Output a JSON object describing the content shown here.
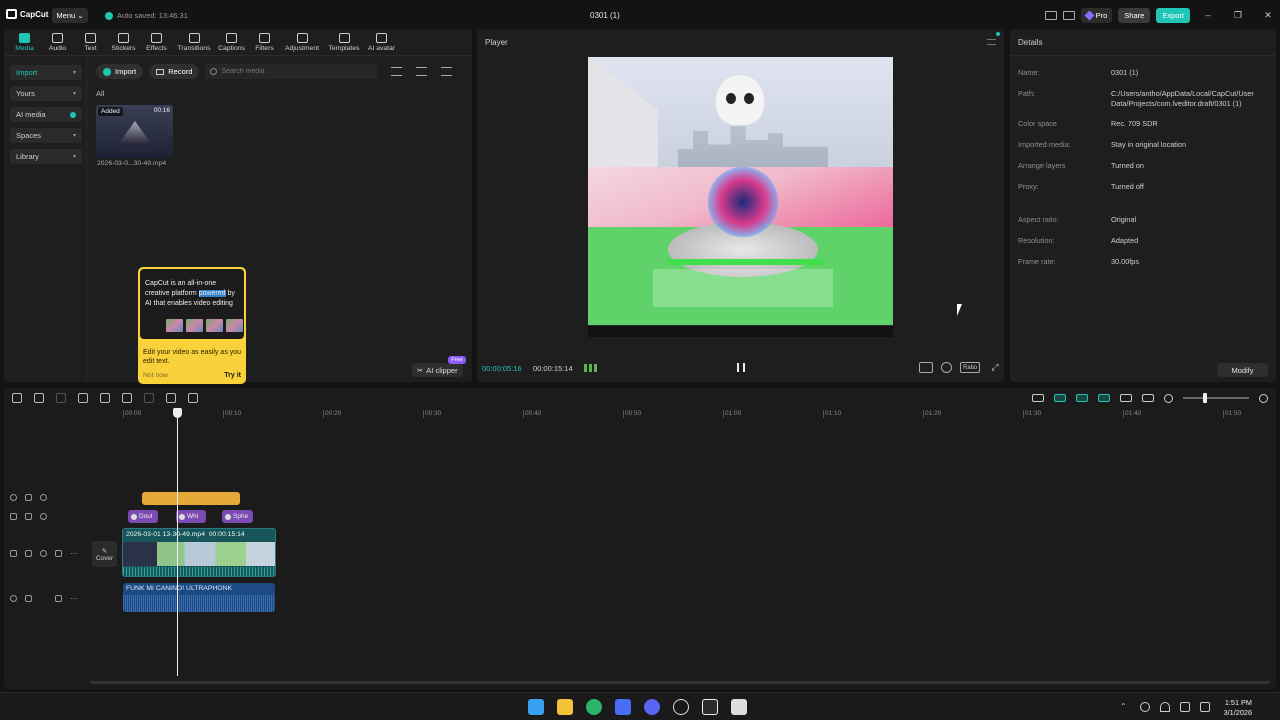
{
  "titlebar": {
    "app_name": "CapCut",
    "menu_label": "Menu",
    "autosave": "Auto saved: 13:46:31",
    "project_title": "0301 (1)",
    "pro_label": "Pro",
    "share_label": "Share",
    "export_label": "Export"
  },
  "media_tabs": [
    {
      "label": "Media",
      "icon": "media-icon",
      "active": true
    },
    {
      "label": "Audio",
      "icon": "audio-icon"
    },
    {
      "label": "Text",
      "icon": "text-icon"
    },
    {
      "label": "Stickers",
      "icon": "sticker-icon"
    },
    {
      "label": "Effects",
      "icon": "effects-icon"
    },
    {
      "label": "Transitions",
      "icon": "transitions-icon"
    },
    {
      "label": "Captions",
      "icon": "captions-icon"
    },
    {
      "label": "Filters",
      "icon": "filters-icon"
    },
    {
      "label": "Adjustment",
      "icon": "adjustment-icon"
    },
    {
      "label": "Templates",
      "icon": "templates-icon"
    },
    {
      "label": "AI avatar",
      "icon": "ai-avatar-icon"
    }
  ],
  "side_nav": [
    {
      "label": "Import",
      "active": true
    },
    {
      "label": "Yours"
    },
    {
      "label": "AI media"
    },
    {
      "label": "Spaces"
    },
    {
      "label": "Library"
    }
  ],
  "media_toolbar": {
    "import_label": "Import",
    "record_label": "Record",
    "search_placeholder": "Search media"
  },
  "media_filter": "All",
  "media_item": {
    "badge": "Added",
    "duration": "00:16",
    "name": "2026-03-0...30-49.mp4"
  },
  "tooltip": {
    "text_before": "CapCut is an all-in-one creative platform ",
    "text_highlight": "powered",
    "text_after": " by AI that enables video editing",
    "body": "Edit your video as easily as you edit text.",
    "not_now": "Not now",
    "try_it": "Try it"
  },
  "ai_clipper": {
    "label": "AI clipper",
    "badge": "Free"
  },
  "player": {
    "title": "Player",
    "current_time": "00:00:05:16",
    "total_time": "00:00:15:14",
    "ratio_label": "Ratio"
  },
  "details": {
    "title": "Details",
    "rows": [
      {
        "key": "Name:",
        "value": "0301 (1)"
      },
      {
        "key": "Path:",
        "value": "C:/Users/antho/AppData/Local/CapCut/User Data/Projects/com.lveditor.draft/0301 (1)"
      },
      {
        "key": "Color space",
        "value": "Rec. 709 SDR"
      },
      {
        "key": "Imported media:",
        "value": "Stay in original location"
      },
      {
        "key": "Arrange layers",
        "value": "Turned on"
      },
      {
        "key": "Proxy:",
        "value": "Turned off"
      },
      {
        "key": "Aspect ratio:",
        "value": "Original"
      },
      {
        "key": "Resolution:",
        "value": "Adapted"
      },
      {
        "key": "Frame rate:",
        "value": "30.00fps"
      }
    ],
    "modify_label": "Modify"
  },
  "timeline": {
    "ticks": [
      "00:00",
      "00:10",
      "00:20",
      "00:30",
      "00:40",
      "00:50",
      "01:00",
      "01:10",
      "01:20",
      "01:30",
      "01:40",
      "01:50"
    ],
    "cover_label": "Cover",
    "effects": [
      "Doul",
      "Whi",
      "Sphe"
    ],
    "video_clip_name": "2026-03-01 13-30-49.mp4",
    "video_clip_duration": "00:00:15:14",
    "audio_clip_name": "FUNK MI CANINO! ULTRAPHONK"
  },
  "taskbar": {
    "time": "1:51 PM",
    "date": "3/1/2026"
  }
}
